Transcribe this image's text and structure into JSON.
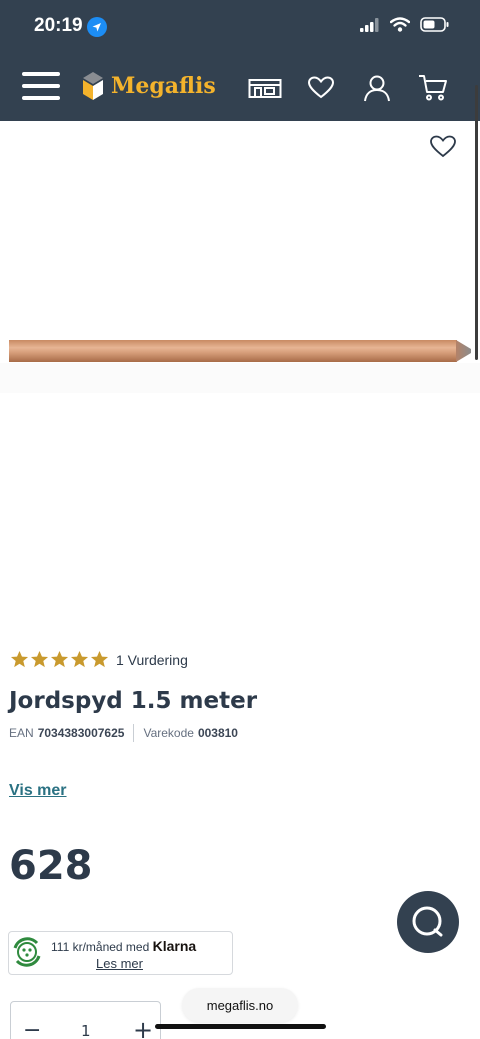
{
  "status_bar": {
    "time": "20:19"
  },
  "brand": {
    "name": "Megaflis",
    "accent_color": "#f4b32c",
    "nav_color": "#334150"
  },
  "nav": {
    "icons": [
      "menu-icon",
      "store-icon",
      "heart-icon",
      "user-icon",
      "cart-icon"
    ]
  },
  "product": {
    "rating_stars": 5,
    "rating_count_label": "1 Vurdering",
    "title": "Jordspyd 1.5 meter",
    "ean_label": "EAN",
    "ean_value": "7034383007625",
    "sku_label": "Varekode",
    "sku_value": "003810",
    "more_link": "Vis mer",
    "price": "628"
  },
  "klarna": {
    "text": "111 kr/måned med",
    "brand": "Klarna",
    "link": "Les mer"
  },
  "quantity": {
    "minus": "−",
    "value": "1",
    "plus": "+"
  },
  "browser": {
    "url": "megaflis.no"
  }
}
